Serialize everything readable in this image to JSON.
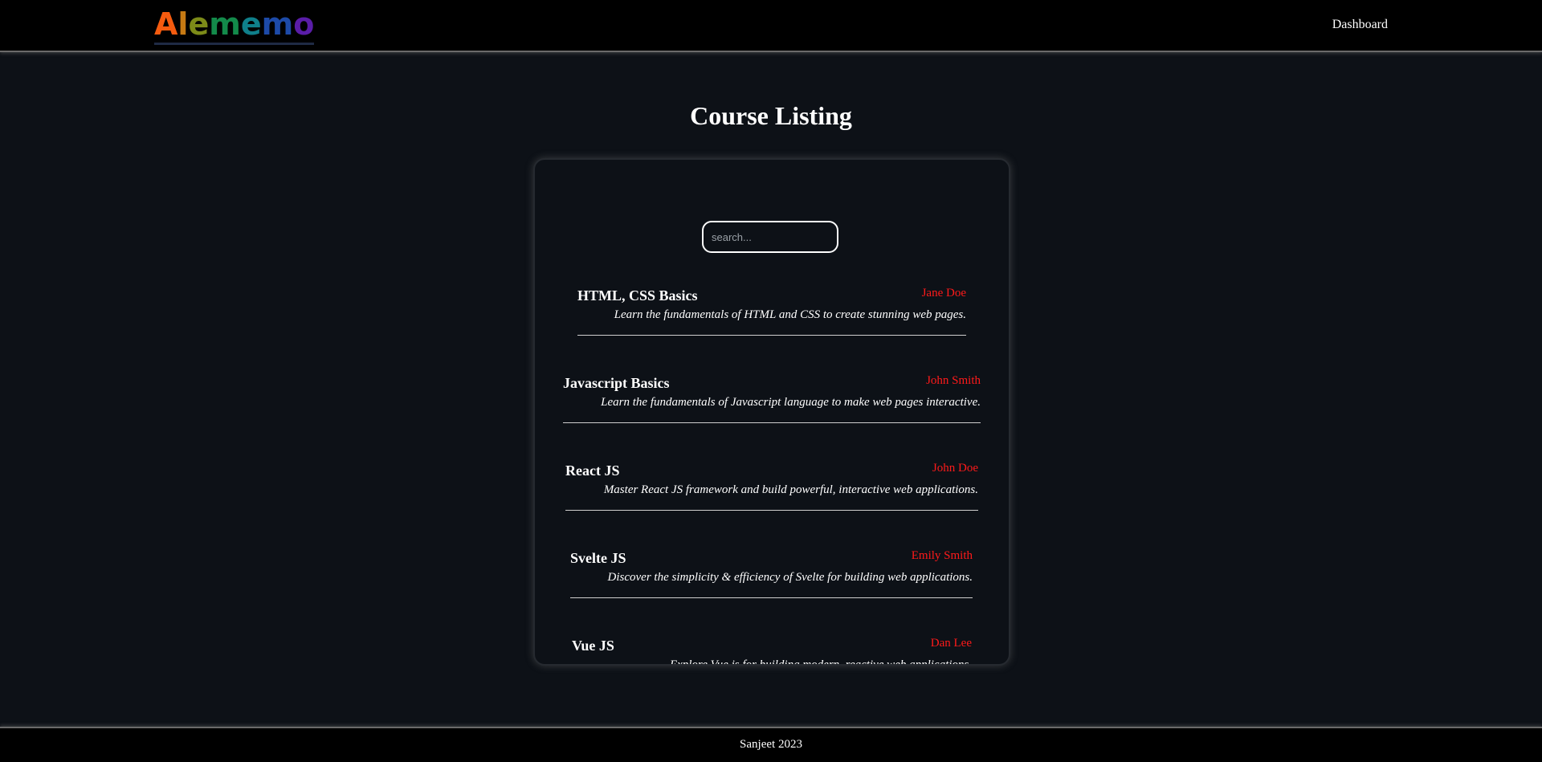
{
  "header": {
    "logo_letters": [
      "A",
      "l",
      "e",
      "m",
      "e",
      "m",
      "o"
    ],
    "nav": {
      "dashboard_label": "Dashboard"
    }
  },
  "main": {
    "title": "Course Listing",
    "search": {
      "placeholder": "search...",
      "value": ""
    },
    "courses": [
      {
        "title": "HTML, CSS Basics",
        "instructor": "Jane Doe",
        "description": "Learn the fundamentals of HTML and CSS to create stunning web pages."
      },
      {
        "title": "Javascript Basics",
        "instructor": "John Smith",
        "description": "Learn the fundamentals of Javascript language to make web pages interactive."
      },
      {
        "title": "React JS",
        "instructor": "John Doe",
        "description": "Master React JS framework and build powerful, interactive web applications."
      },
      {
        "title": "Svelte JS",
        "instructor": "Emily Smith",
        "description": "Discover the simplicity & efficiency of Svelte for building web applications."
      },
      {
        "title": "Vue JS",
        "instructor": "Dan Lee",
        "description": "Explore Vue.js for building modern, reactive web applications."
      }
    ]
  },
  "footer": {
    "credit": "Sanjeet 2023"
  },
  "colors": {
    "background": "#0d1117",
    "bar": "#000000",
    "instructor": "#ff1a1a",
    "text": "#ffffff"
  }
}
